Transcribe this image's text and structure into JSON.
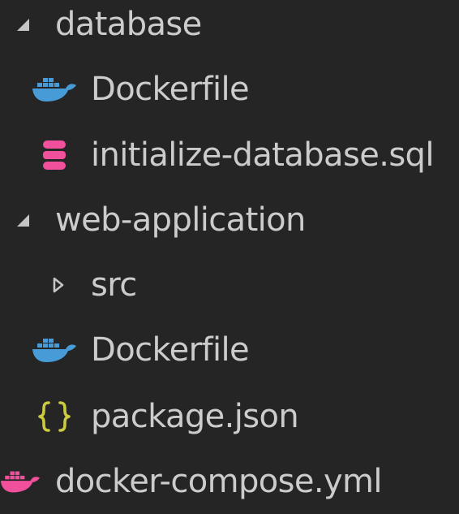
{
  "explorer": {
    "items": [
      {
        "label": "database",
        "kind": "folder",
        "expanded": true,
        "icon": "chevron-down-icon"
      },
      {
        "label": "Dockerfile",
        "kind": "file",
        "icon": "docker-icon",
        "icon_color": "#479bd6"
      },
      {
        "label": "initialize-database.sql",
        "kind": "file",
        "icon": "database-icon",
        "icon_color": "#f0509c"
      },
      {
        "label": "web-application",
        "kind": "folder",
        "expanded": true,
        "icon": "chevron-down-icon"
      },
      {
        "label": "src",
        "kind": "folder",
        "expanded": false,
        "icon": "chevron-right-icon"
      },
      {
        "label": "Dockerfile",
        "kind": "file",
        "icon": "docker-icon",
        "icon_color": "#479bd6"
      },
      {
        "label": "package.json",
        "kind": "file",
        "icon": "json-braces-icon",
        "icon_color": "#cbcb41"
      },
      {
        "label": "docker-compose.yml",
        "kind": "file",
        "icon": "docker-icon",
        "icon_color": "#f0509c"
      }
    ]
  },
  "colors": {
    "background": "#252526",
    "text": "#cccccc",
    "twisty": "#c5c5c5",
    "docker_blue": "#479bd6",
    "sql_pink": "#f0509c",
    "json_yellow": "#cbcb41"
  }
}
